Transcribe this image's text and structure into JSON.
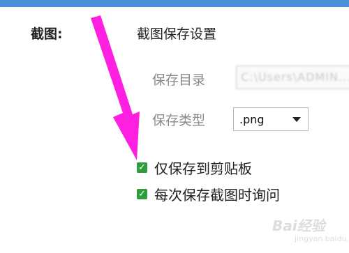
{
  "header": {
    "section_label": "截图:",
    "section_title": "截图保存设置"
  },
  "save_dir": {
    "label": "保存目录",
    "value": "C:\\Users\\ADMIN..."
  },
  "save_type": {
    "label": "保存类型",
    "selected": ".png"
  },
  "options": [
    {
      "label": "仅保存到剪贴板",
      "checked": true
    },
    {
      "label": "每次保存截图时询问",
      "checked": true
    }
  ],
  "colors": {
    "topbar": "#4a90d9",
    "checkbox": "#2e9e3c",
    "annotation_arrow": "#ff1fe0"
  },
  "icons": {
    "checkbox": "check-icon",
    "dropdown": "chevron-down-icon",
    "annotation": "arrow-annotation"
  },
  "watermark": {
    "brand": "Bai经验",
    "site": "jingyan.baidu.com"
  }
}
